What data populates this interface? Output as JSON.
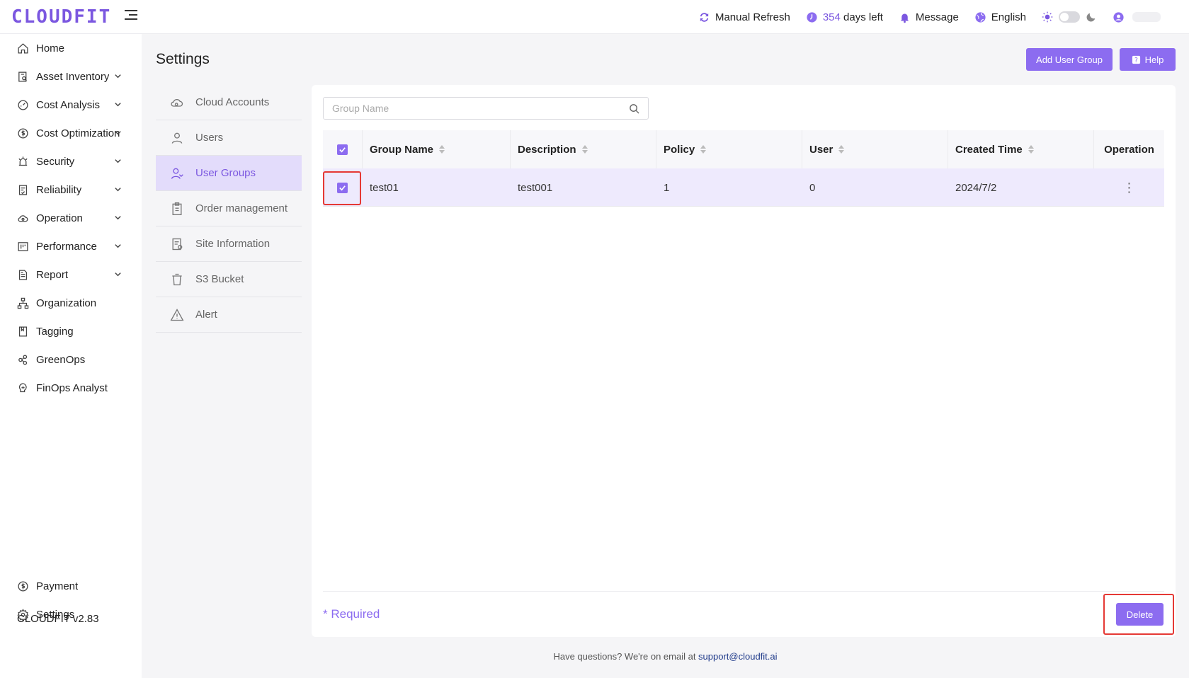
{
  "header": {
    "logo": "CLOUDFIT",
    "manual_refresh": "Manual Refresh",
    "days_count": "354",
    "days_suffix": "days left",
    "message": "Message",
    "language": "English"
  },
  "sidebar": {
    "items": [
      {
        "label": "Home",
        "icon": "home-icon",
        "chevron": false
      },
      {
        "label": "Asset Inventory",
        "icon": "inventory-icon",
        "chevron": true
      },
      {
        "label": "Cost Analysis",
        "icon": "gauge-icon",
        "chevron": true
      },
      {
        "label": "Cost Optimization",
        "icon": "dollar-icon",
        "chevron": true
      },
      {
        "label": "Security",
        "icon": "alarm-icon",
        "chevron": true
      },
      {
        "label": "Reliability",
        "icon": "doc-check-icon",
        "chevron": true
      },
      {
        "label": "Operation",
        "icon": "cloud-icon",
        "chevron": true
      },
      {
        "label": "Performance",
        "icon": "board-icon",
        "chevron": true
      },
      {
        "label": "Report",
        "icon": "report-icon",
        "chevron": true
      },
      {
        "label": "Organization",
        "icon": "org-icon",
        "chevron": false
      },
      {
        "label": "Tagging",
        "icon": "tag-icon",
        "chevron": false
      },
      {
        "label": "GreenOps",
        "icon": "leaf-icon",
        "chevron": false
      },
      {
        "label": "FinOps Analyst",
        "icon": "brain-icon",
        "chevron": false
      }
    ],
    "payment": "Payment",
    "settings": "Settings",
    "version": "CLOUDFIT v2.83"
  },
  "page": {
    "title": "Settings",
    "add_user_group": "Add User Group",
    "help": "Help"
  },
  "sub_menu": {
    "items": [
      {
        "label": "Cloud Accounts",
        "icon": "cloud-accounts-icon",
        "active": false
      },
      {
        "label": "Users",
        "icon": "user-icon",
        "active": false
      },
      {
        "label": "User Groups",
        "icon": "user-group-icon",
        "active": true
      },
      {
        "label": "Order management",
        "icon": "clipboard-icon",
        "active": false
      },
      {
        "label": "Site Information",
        "icon": "site-info-icon",
        "active": false
      },
      {
        "label": "S3 Bucket",
        "icon": "bucket-icon",
        "active": false
      },
      {
        "label": "Alert",
        "icon": "warning-icon",
        "active": false
      }
    ]
  },
  "search": {
    "placeholder": "Group Name",
    "value": ""
  },
  "table": {
    "columns": [
      "Group Name",
      "Description",
      "Policy",
      "User",
      "Created Time",
      "Operation"
    ],
    "rows": [
      {
        "group_name": "test01",
        "description": "test001",
        "policy": "1",
        "user": "0",
        "created_time": "2024/7/2",
        "selected": true
      }
    ]
  },
  "form": {
    "required": "* Required",
    "delete": "Delete"
  },
  "footer": {
    "text": "Have questions? We're on email at ",
    "email": "support@cloudfit.ai"
  },
  "colors": {
    "accent": "#8c6cf0",
    "brand": "#7b57e0",
    "highlight": "#e53935"
  }
}
